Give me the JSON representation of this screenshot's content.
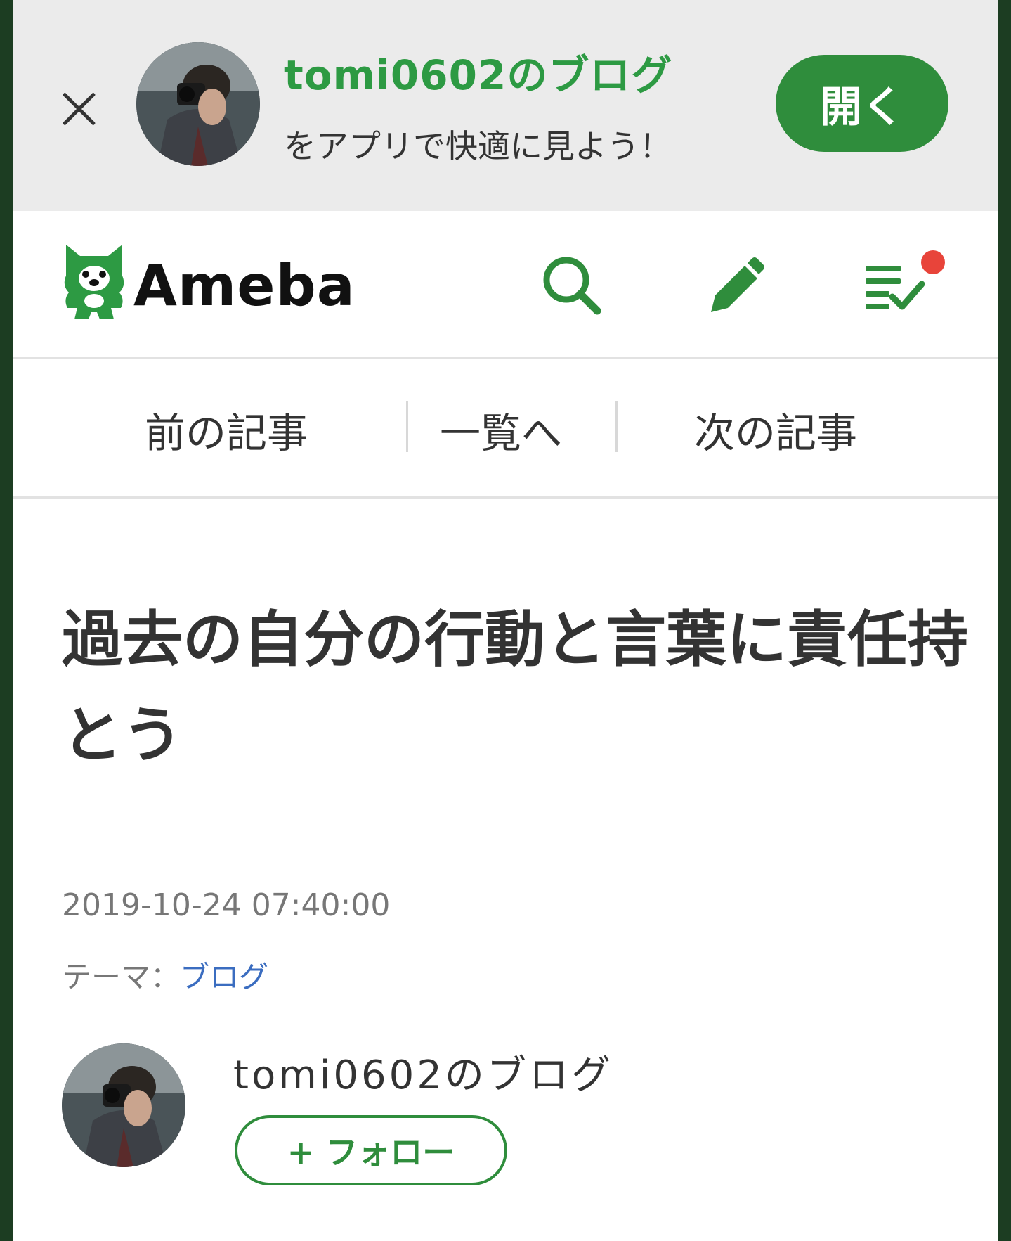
{
  "banner": {
    "blog_name": "tomi0602のブログ",
    "subtitle": "をアプリで快適に見よう！",
    "open_label": "開く",
    "close_icon": "close-icon"
  },
  "header": {
    "logo_text": "Ameba",
    "icons": [
      "search-icon",
      "pencil-icon",
      "checklist-icon"
    ],
    "notification_color": "#e8443a",
    "accent_color": "#2f8d3c"
  },
  "article_nav": {
    "prev_label": "前の記事",
    "list_label": "一覧へ",
    "next_label": "次の記事"
  },
  "article": {
    "title": "過去の自分の行動と言葉に責任持とう",
    "datetime": "2019-10-24 07:40:00",
    "theme_label": "テーマ：",
    "theme_value": "ブログ"
  },
  "author": {
    "name": "tomi0602のブログ",
    "follow_label": "+ フォロー"
  }
}
